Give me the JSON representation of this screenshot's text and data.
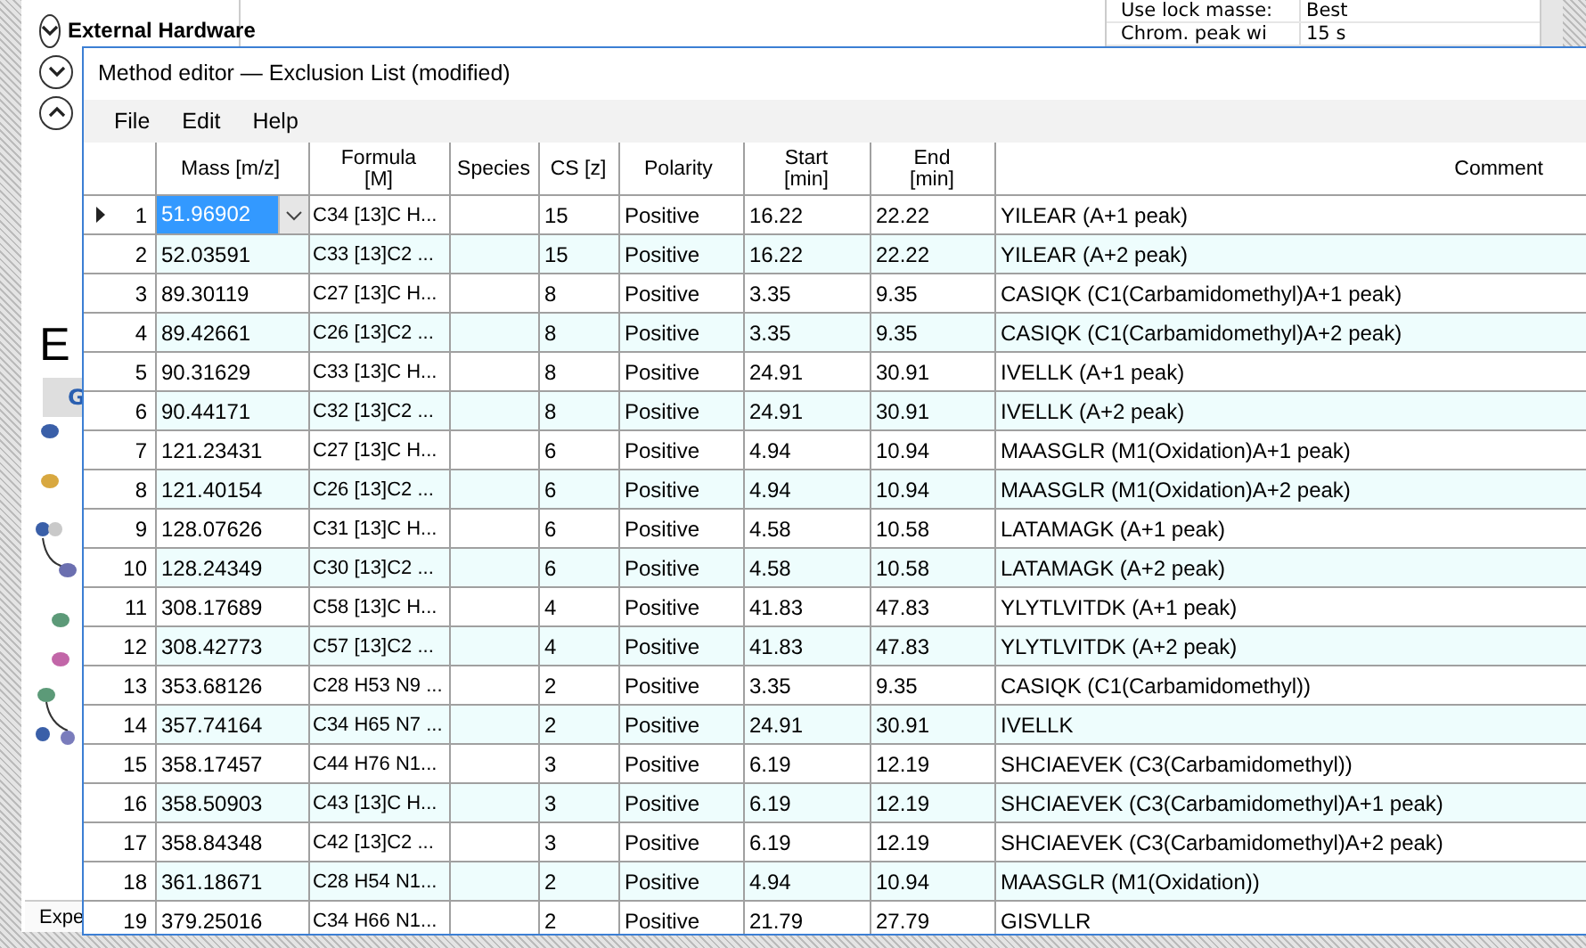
{
  "background": {
    "sections": [
      {
        "label": "External Hardware",
        "expanded": false
      },
      {
        "expanded": false
      },
      {
        "expanded": true
      }
    ],
    "heading": "E",
    "nav_item": {
      "label": "G",
      "selected": true
    },
    "bottom_tab": "Expe",
    "properties": [
      {
        "name": "Use lock masse:",
        "value": "Best"
      },
      {
        "name": "Chrom. peak wi",
        "value": "15 s"
      }
    ]
  },
  "dialog": {
    "title": "Method editor — Exclusion List (modified)",
    "menu": [
      "File",
      "Edit",
      "Help"
    ],
    "columns": [
      "Mass [m/z]",
      "Formula\n[M]",
      "Species",
      "CS [z]",
      "Polarity",
      "Start\n[min]",
      "End\n[min]",
      "Comment"
    ],
    "rows": [
      {
        "number": "1",
        "selected": true,
        "cells": [
          "51.96902",
          "C34 [13]C H...",
          "",
          "15",
          "Positive",
          "16.22",
          "22.22",
          "YILEAR (A+1 peak)"
        ]
      },
      {
        "number": "2",
        "selected": false,
        "cells": [
          "52.03591",
          "C33 [13]C2 ...",
          "",
          "15",
          "Positive",
          "16.22",
          "22.22",
          "YILEAR (A+2 peak)"
        ]
      },
      {
        "number": "3",
        "selected": false,
        "cells": [
          "89.30119",
          "C27 [13]C H...",
          "",
          "8",
          "Positive",
          "3.35",
          "9.35",
          "CASIQK (C1(Carbamidomethyl)A+1 peak)"
        ]
      },
      {
        "number": "4",
        "selected": false,
        "cells": [
          "89.42661",
          "C26 [13]C2 ...",
          "",
          "8",
          "Positive",
          "3.35",
          "9.35",
          "CASIQK (C1(Carbamidomethyl)A+2 peak)"
        ]
      },
      {
        "number": "5",
        "selected": false,
        "cells": [
          "90.31629",
          "C33 [13]C H...",
          "",
          "8",
          "Positive",
          "24.91",
          "30.91",
          "IVELLK (A+1 peak)"
        ]
      },
      {
        "number": "6",
        "selected": false,
        "cells": [
          "90.44171",
          "C32 [13]C2 ...",
          "",
          "8",
          "Positive",
          "24.91",
          "30.91",
          "IVELLK (A+2 peak)"
        ]
      },
      {
        "number": "7",
        "selected": false,
        "cells": [
          "121.23431",
          "C27 [13]C H...",
          "",
          "6",
          "Positive",
          "4.94",
          "10.94",
          "MAASGLR (M1(Oxidation)A+1 peak)"
        ]
      },
      {
        "number": "8",
        "selected": false,
        "cells": [
          "121.40154",
          "C26 [13]C2 ...",
          "",
          "6",
          "Positive",
          "4.94",
          "10.94",
          "MAASGLR (M1(Oxidation)A+2 peak)"
        ]
      },
      {
        "number": "9",
        "selected": false,
        "cells": [
          "128.07626",
          "C31 [13]C H...",
          "",
          "6",
          "Positive",
          "4.58",
          "10.58",
          "LATAMAGK (A+1 peak)"
        ]
      },
      {
        "number": "10",
        "selected": false,
        "cells": [
          "128.24349",
          "C30 [13]C2 ...",
          "",
          "6",
          "Positive",
          "4.58",
          "10.58",
          "LATAMAGK (A+2 peak)"
        ]
      },
      {
        "number": "11",
        "selected": false,
        "cells": [
          "308.17689",
          "C58 [13]C H...",
          "",
          "4",
          "Positive",
          "41.83",
          "47.83",
          "YLYTLVITDK (A+1 peak)"
        ]
      },
      {
        "number": "12",
        "selected": false,
        "cells": [
          "308.42773",
          "C57 [13]C2 ...",
          "",
          "4",
          "Positive",
          "41.83",
          "47.83",
          "YLYTLVITDK (A+2 peak)"
        ]
      },
      {
        "number": "13",
        "selected": false,
        "cells": [
          "353.68126",
          "C28 H53 N9 ...",
          "",
          "2",
          "Positive",
          "3.35",
          "9.35",
          "CASIQK (C1(Carbamidomethyl))"
        ]
      },
      {
        "number": "14",
        "selected": false,
        "cells": [
          "357.74164",
          "C34 H65 N7 ...",
          "",
          "2",
          "Positive",
          "24.91",
          "30.91",
          "IVELLK"
        ]
      },
      {
        "number": "15",
        "selected": false,
        "cells": [
          "358.17457",
          "C44 H76 N1...",
          "",
          "3",
          "Positive",
          "6.19",
          "12.19",
          "SHCIAEVEK (C3(Carbamidomethyl))"
        ]
      },
      {
        "number": "16",
        "selected": false,
        "cells": [
          "358.50903",
          "C43 [13]C H...",
          "",
          "3",
          "Positive",
          "6.19",
          "12.19",
          "SHCIAEVEK (C3(Carbamidomethyl)A+1 peak)"
        ]
      },
      {
        "number": "17",
        "selected": false,
        "cells": [
          "358.84348",
          "C42 [13]C2 ...",
          "",
          "3",
          "Positive",
          "6.19",
          "12.19",
          "SHCIAEVEK (C3(Carbamidomethyl)A+2 peak)"
        ]
      },
      {
        "number": "18",
        "selected": false,
        "cells": [
          "361.18671",
          "C28 H54 N1...",
          "",
          "2",
          "Positive",
          "4.94",
          "10.94",
          "MAASGLR (M1(Oxidation))"
        ]
      },
      {
        "number": "19",
        "selected": false,
        "cells": [
          "379.25016",
          "C34 H66 N1...",
          "",
          "2",
          "Positive",
          "21.79",
          "27.79",
          "GISVLLR"
        ]
      }
    ]
  }
}
